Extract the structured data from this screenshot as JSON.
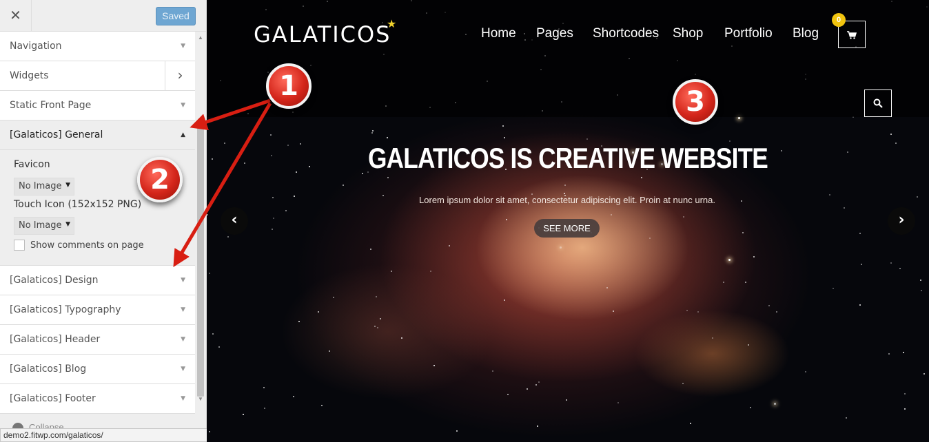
{
  "customizer": {
    "close_icon": "close-icon",
    "saved_label": "Saved",
    "sections": [
      {
        "label": "Navigation"
      },
      {
        "label": "Widgets"
      },
      {
        "label": "Static Front Page"
      },
      {
        "label": "[Galaticos] General"
      },
      {
        "label": "[Galaticos] Design"
      },
      {
        "label": "[Galaticos] Typography"
      },
      {
        "label": "[Galaticos] Header"
      },
      {
        "label": "[Galaticos] Blog"
      },
      {
        "label": "[Galaticos] Footer"
      }
    ],
    "general": {
      "favicon_label": "Favicon",
      "favicon_value": "No Image",
      "touch_icon_label": "Touch Icon (152x152 PNG)",
      "touch_icon_value": "No Image",
      "show_comments_label": "Show comments on page",
      "show_comments_checked": false
    },
    "collapse_label": "Collapse"
  },
  "statusbar": {
    "url": "demo2.fitwp.com/galaticos/"
  },
  "site": {
    "logo": "GALATICOS",
    "nav": [
      "Home",
      "Pages",
      "Shortcodes",
      "Shop",
      "Portfolio",
      "Blog"
    ],
    "cart_count": "0",
    "hero": {
      "title": "GALATICOS IS CREATIVE WEBSITE",
      "text": "Lorem ipsum dolor sit amet, consectetur adipiscing elit. Proin at nunc urna.",
      "button": "SEE MORE"
    }
  },
  "annotations": {
    "markers": [
      "1",
      "2",
      "3"
    ],
    "color": "#d81e12"
  },
  "colors": {
    "accent_blue": "#6ea6d2",
    "cart_badge": "#f1c40f"
  }
}
